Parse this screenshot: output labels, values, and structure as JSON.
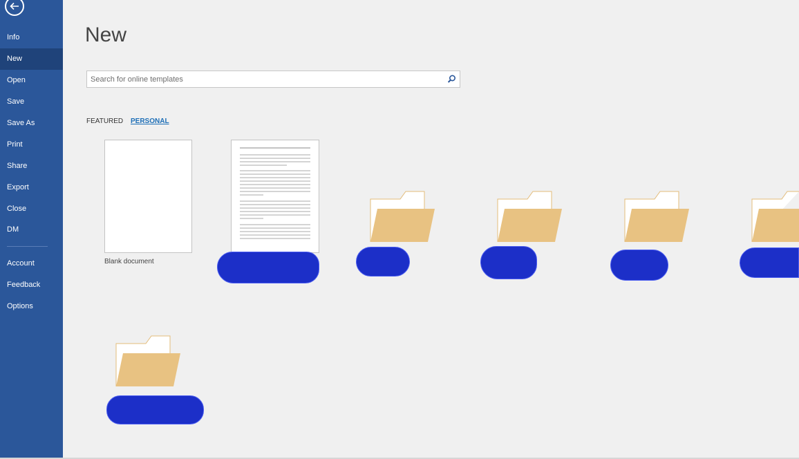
{
  "sidebar": {
    "items": [
      {
        "label": "Info"
      },
      {
        "label": "New"
      },
      {
        "label": "Open"
      },
      {
        "label": "Save"
      },
      {
        "label": "Save As"
      },
      {
        "label": "Print"
      },
      {
        "label": "Share"
      },
      {
        "label": "Export"
      },
      {
        "label": "Close"
      },
      {
        "label": "DM"
      },
      {
        "label": "Account"
      },
      {
        "label": "Feedback"
      },
      {
        "label": "Options"
      }
    ]
  },
  "main": {
    "title": "New",
    "search": {
      "placeholder": "Search for online templates",
      "value": ""
    },
    "tabs": [
      {
        "label": "FEATURED"
      },
      {
        "label": "PERSONAL"
      }
    ],
    "templates": [
      {
        "label": "Blank document"
      }
    ]
  },
  "colors": {
    "sidebar_bg": "#2b579a",
    "sidebar_active": "#1f437a",
    "page_bg": "#f0f0f0",
    "accent_link": "#1e6fb7",
    "folder_fill": "#e8c282",
    "redaction": "#1c2fc8"
  },
  "icons": {
    "back": "back-arrow-icon",
    "search": "search-icon",
    "folder": "folder-icon"
  }
}
